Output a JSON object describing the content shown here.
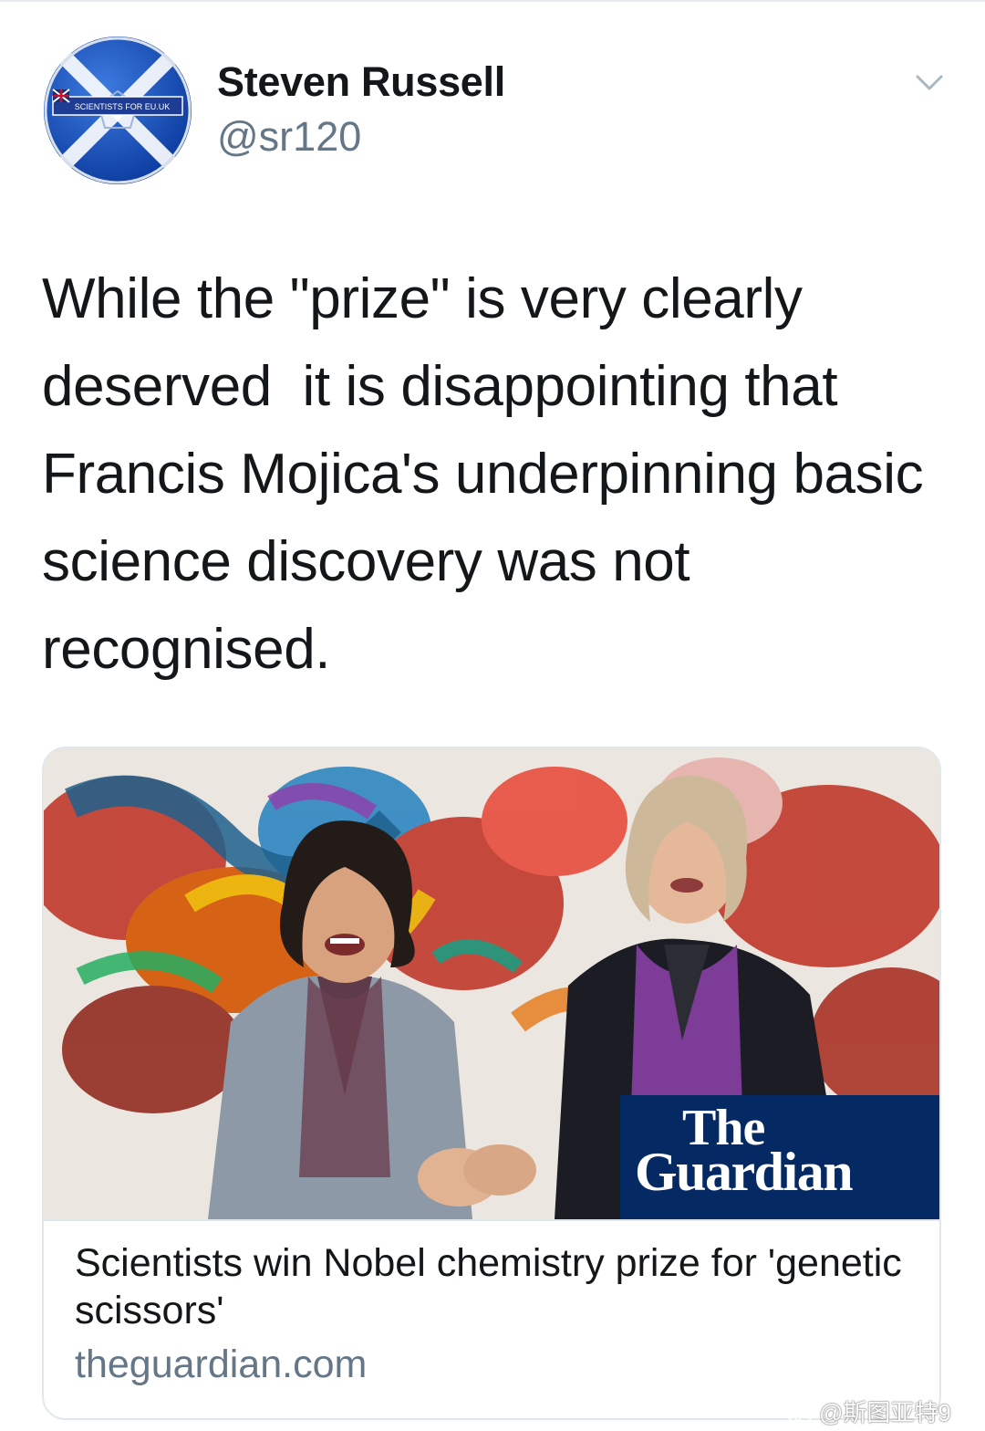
{
  "tweet": {
    "author": {
      "display_name": "Steven Russell",
      "handle": "@sr120",
      "avatar_text": "SCIENTISTS FOR EU.UK"
    },
    "text": "While the \"prize\" is very clearly deserved  it is disappointing that Francis Mojica's underpinning basic science discovery was not recognised.",
    "menu_icon": "chevron-down-icon"
  },
  "link_card": {
    "image_brand": {
      "line1": "The",
      "line2": "Guardian"
    },
    "title": "Scientists win Nobel chemistry prize for 'genetic scissors'",
    "domain": "theguardian.com"
  },
  "watermark": {
    "text": "@斯图亚特9",
    "icon": "weibo-icon"
  },
  "colors": {
    "text_primary": "#14171a",
    "text_secondary": "#657786",
    "border": "#e1e8ed",
    "guardian_blue": "#052962"
  }
}
